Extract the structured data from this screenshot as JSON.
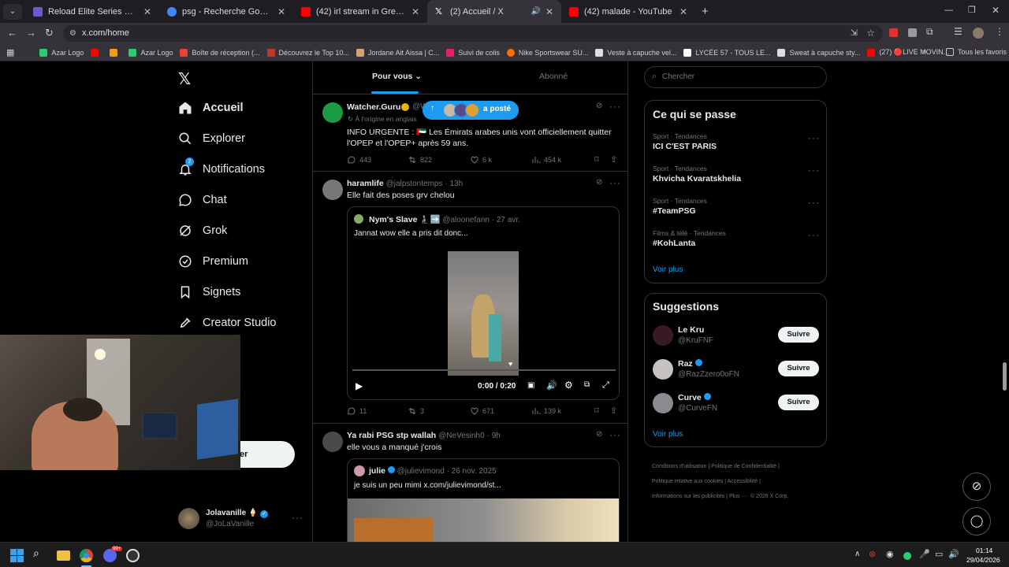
{
  "browser": {
    "tabs": [
      {
        "title": "Reload Elite Series Opens in Eu",
        "color": "#6a5acd"
      },
      {
        "title": "psg - Recherche Google",
        "color": "#4285f4"
      },
      {
        "title": "(42) irl stream in Grenada go",
        "color": "#ff0000"
      },
      {
        "title": "(2) Accueil / X",
        "color": "#ffffff"
      },
      {
        "title": "(42) malade - YouTube",
        "color": "#ff0000"
      }
    ],
    "url": "x.com/home",
    "bookmarks": [
      "Azar Logo",
      "",
      "",
      "Azar Logo",
      "Boîte de réception (...",
      "Découvrez le Top 10...",
      "Jordane Ait Aissa | C...",
      "Suivi de colis",
      "Nike Sportswear SU...",
      "Veste à capuche vel...",
      "LYCÉE 57 - TOUS LE...",
      "Sweat à capuche sty...",
      "(27) 🔴LIVE MOVIN..."
    ],
    "all_bookmarks": "Tous les favoris"
  },
  "nav": {
    "home": "Accueil",
    "explore": "Explorer",
    "notifications": "Notifications",
    "notif_badge": "2",
    "chat": "Chat",
    "grok": "Grok",
    "premium": "Premium",
    "bookmarks": "Signets",
    "creator": "Creator Studio",
    "post_button_partial": "er"
  },
  "account": {
    "name": "Jolavanille",
    "handle": "@JoLaVanille"
  },
  "feed": {
    "tab_for_you": "Pour vous",
    "tab_following": "Abonné",
    "posted_pill": "a posté",
    "t1": {
      "name": "Watcher.Guru",
      "handle": "@W",
      "translated": "À l'origine en anglais",
      "text": "INFO URGENTE : 🇦🇪 Les Émirats arabes unis vont officiellement quitter l'OPEP et l'OPEP+ après 59 ans.",
      "replies": "443",
      "reposts": "822",
      "likes": "6 k",
      "views": "454 k"
    },
    "t2": {
      "name": "haramlife",
      "handle": "@jalpstontemps",
      "time": "· 13h",
      "text": "Elle fait des poses grv chelou",
      "q_name": "Nym's Slave 🧎‍♂️➡️",
      "q_handle": "@aloonefann · 27 avr.",
      "q_text": "Jannat wow elle a pris dit donc...",
      "video_time": "0:00 / 0:20",
      "replies": "11",
      "reposts": "3",
      "likes": "671",
      "views": "139 k"
    },
    "t3": {
      "name": "Ya rabi PSG stp wallah",
      "handle": "@NeVesinh0",
      "time": "· 9h",
      "text": "elle vous a manqué j'crois",
      "q_name": "julie",
      "q_handle": "@julievimond · 26 nov. 2025",
      "q_text": "je suis un peu mimi  x.com/julievimond/st..."
    }
  },
  "right": {
    "search_placeholder": "Chercher",
    "trends_title": "Ce qui se passe",
    "trends": [
      {
        "cat": "Sport · Tendances",
        "name": "ICI C'EST PARIS"
      },
      {
        "cat": "Sport · Tendances",
        "name": "Khvicha Kvaratskhelia"
      },
      {
        "cat": "Sport · Tendances",
        "name": "#TeamPSG"
      },
      {
        "cat": "Films & télé · Tendances",
        "name": "#KohLanta"
      }
    ],
    "see_more": "Voir plus",
    "sugg_title": "Suggestions",
    "suggestions": [
      {
        "name": "Le Kru",
        "handle": "@KruFNF",
        "button": "Suivre"
      },
      {
        "name": "Raz",
        "handle": "@RazZzero0oFN",
        "button": "Suivre"
      },
      {
        "name": "Curve",
        "handle": "@CurveFN",
        "button": "Suivre"
      }
    ],
    "see_more2": "Voir plus",
    "footer": [
      "Conditions d'utilisation",
      "Politique de Confidentialité",
      "Politique relative aux cookies",
      "Accessibilité",
      "Informations sur les publicités",
      "Plus ···",
      "© 2026 X Corp."
    ]
  },
  "taskbar": {
    "time": "01:14",
    "date": "29/04/2026",
    "discord_badge": "99+"
  },
  "colors": {
    "accent": "#1d9bf0",
    "bg": "#000000",
    "border": "#2f3336"
  }
}
